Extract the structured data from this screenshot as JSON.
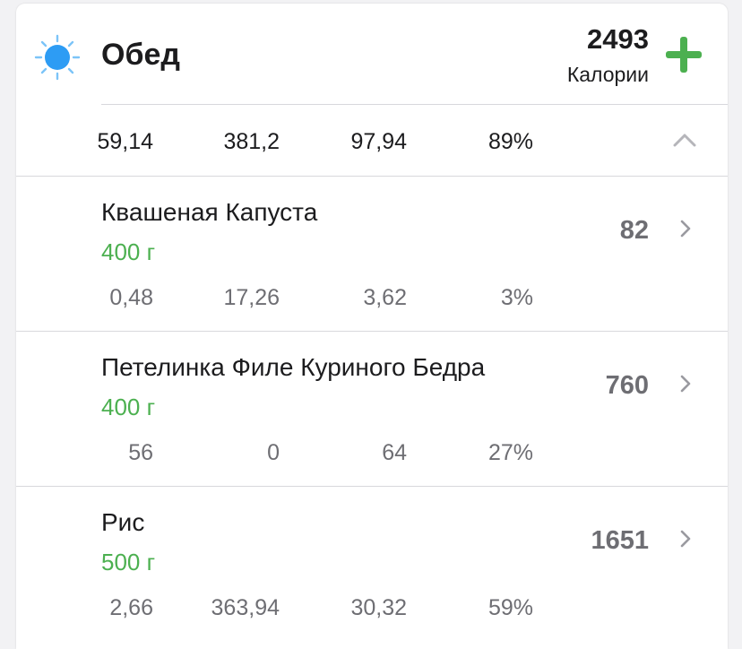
{
  "meal": {
    "title": "Обед",
    "icon": "sun-icon",
    "calories_total": "2493",
    "calories_label": "Калории",
    "add_icon": "plus-icon",
    "accent_color": "#4cb050",
    "summary": [
      "59,14",
      "381,2",
      "97,94",
      "89%"
    ],
    "collapse_icon": "chevron-up-icon"
  },
  "items": [
    {
      "name": "Квашеная Капуста",
      "weight": "400 г",
      "calories": "82",
      "values": [
        "0,48",
        "17,26",
        "3,62",
        "3%"
      ]
    },
    {
      "name": "Петелинка Филе Куриного Бедра",
      "weight": "400 г",
      "calories": "760",
      "values": [
        "56",
        "0",
        "64",
        "27%"
      ]
    },
    {
      "name": "Рис",
      "weight": "500 г",
      "calories": "1651",
      "values": [
        "2,66",
        "363,94",
        "30,32",
        "59%"
      ]
    }
  ]
}
